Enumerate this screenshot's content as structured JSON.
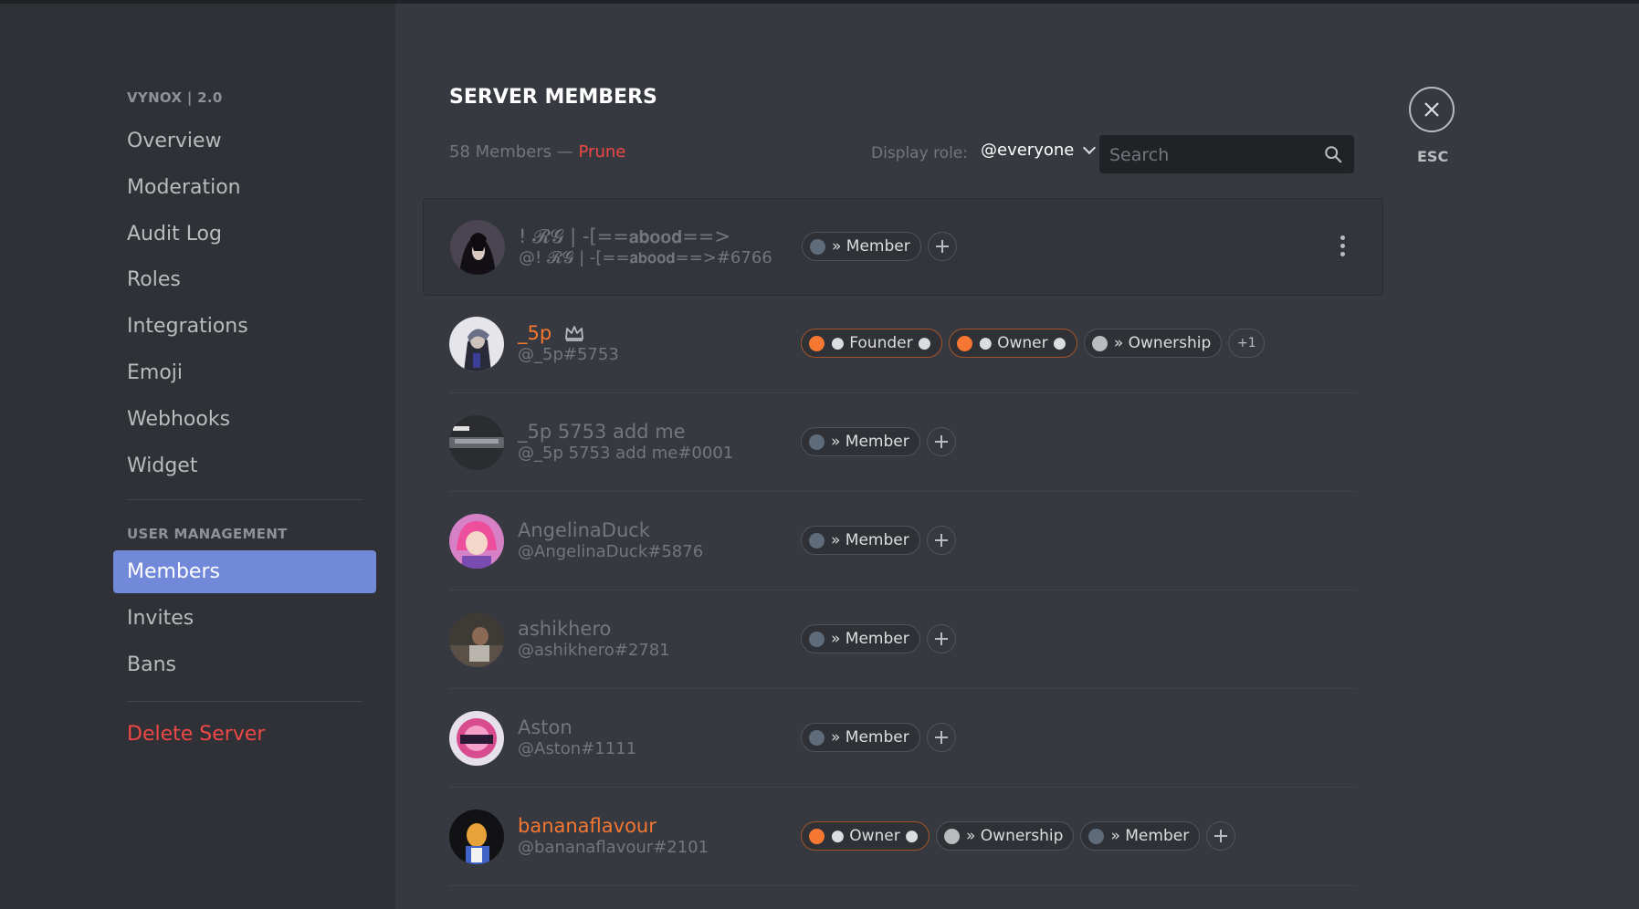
{
  "sidebar": {
    "server_header": "VYNOX | 2.0",
    "server_items": [
      {
        "label": "Overview"
      },
      {
        "label": "Moderation"
      },
      {
        "label": "Audit Log"
      },
      {
        "label": "Roles"
      },
      {
        "label": "Integrations"
      },
      {
        "label": "Emoji"
      },
      {
        "label": "Webhooks"
      },
      {
        "label": "Widget"
      }
    ],
    "user_header": "USER MANAGEMENT",
    "user_items": [
      {
        "label": "Members",
        "active": true
      },
      {
        "label": "Invites"
      },
      {
        "label": "Bans"
      }
    ],
    "delete_label": "Delete Server"
  },
  "header": {
    "title": "SERVER MEMBERS",
    "member_count": "58 Members — ",
    "prune_label": "Prune",
    "display_role_label": "Display role:",
    "display_role_value": "@everyone",
    "search_placeholder": "Search",
    "close_label": "ESC"
  },
  "colors": {
    "accent": "#7289da",
    "danger": "#f04747",
    "orange_role": "#f57731"
  },
  "members": [
    {
      "display_name": "! 𝓡𝓖 | -[==𝗮𝗯𝗼𝗼𝗱==>",
      "tag": "@! 𝓡𝓖 | -[==𝗮𝗯𝗼𝗼𝗱==>#6766",
      "roles": [
        {
          "label": "» Member",
          "color": "gray"
        }
      ],
      "add_role": true,
      "hovered": true
    },
    {
      "display_name": "_5p",
      "tag": "@_5p#5753",
      "owner": true,
      "name_color": "orange",
      "roles": [
        {
          "label": "● Founder ●",
          "color": "orange"
        },
        {
          "label": "● Owner ●",
          "color": "orange"
        },
        {
          "label": "» Ownership",
          "color": "light"
        }
      ],
      "more_roles": "+1"
    },
    {
      "display_name": "_5p 5753 add me",
      "tag": "@_5p 5753 add me#0001",
      "roles": [
        {
          "label": "» Member",
          "color": "gray"
        }
      ],
      "add_role": true
    },
    {
      "display_name": "AngelinaDuck",
      "tag": "@AngelinaDuck#5876",
      "roles": [
        {
          "label": "» Member",
          "color": "gray"
        }
      ],
      "add_role": true
    },
    {
      "display_name": "ashikhero",
      "tag": "@ashikhero#2781",
      "roles": [
        {
          "label": "» Member",
          "color": "gray"
        }
      ],
      "add_role": true
    },
    {
      "display_name": "Aston",
      "tag": "@Aston#1111",
      "roles": [
        {
          "label": "» Member",
          "color": "gray"
        }
      ],
      "add_role": true
    },
    {
      "display_name": "bananaflavour",
      "tag": "@bananaflavour#2101",
      "name_color": "orange",
      "roles": [
        {
          "label": "● Owner ●",
          "color": "orange"
        },
        {
          "label": "» Ownership",
          "color": "light"
        },
        {
          "label": "» Member",
          "color": "gray"
        }
      ],
      "add_role": true
    }
  ]
}
